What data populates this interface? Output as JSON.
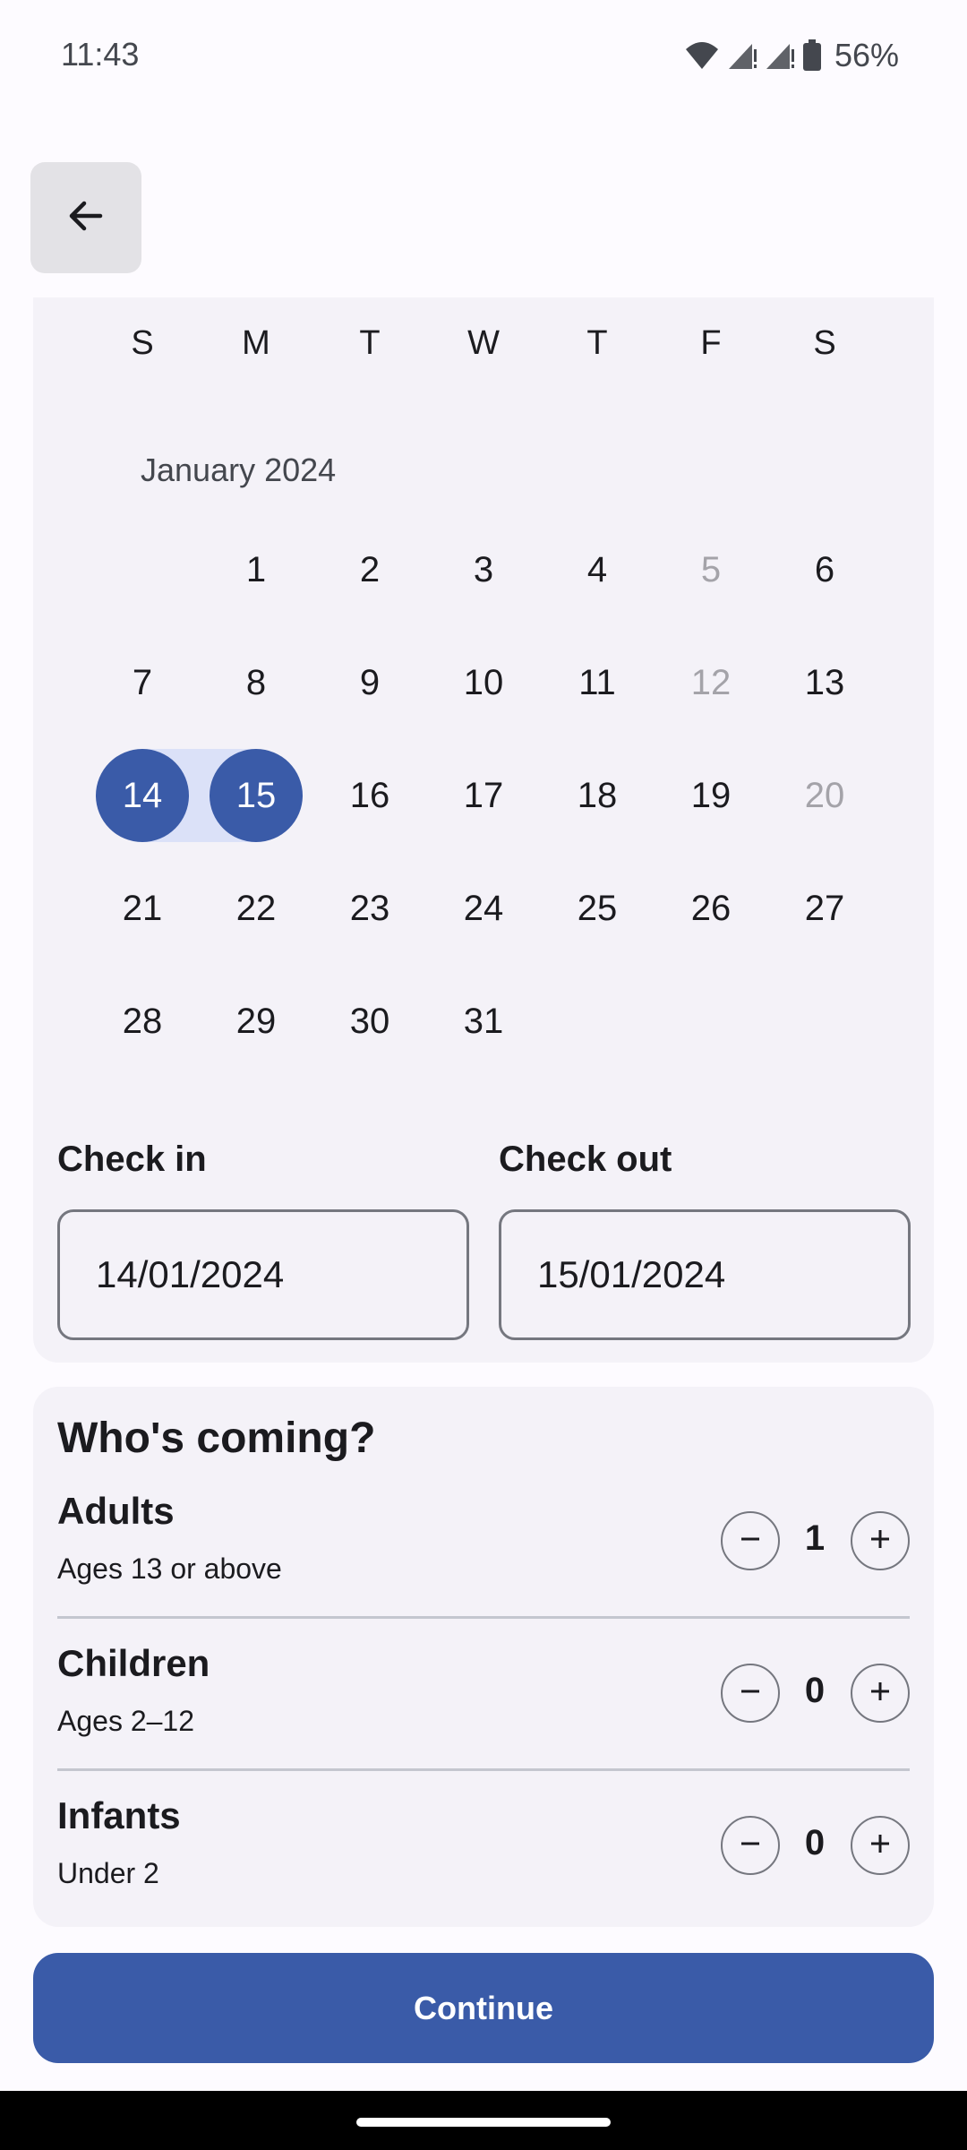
{
  "status_bar": {
    "time": "11:43",
    "battery": "56%",
    "icons": [
      "wifi-icon",
      "signal-icon",
      "signal-icon",
      "battery-icon"
    ]
  },
  "header": {
    "back_icon": "arrow-left-icon"
  },
  "calendar": {
    "weekdays": [
      "S",
      "M",
      "T",
      "W",
      "T",
      "F",
      "S"
    ],
    "month_label": "January 2024",
    "weeks": [
      [
        null,
        {
          "d": "1"
        },
        {
          "d": "2"
        },
        {
          "d": "3"
        },
        {
          "d": "4"
        },
        {
          "d": "5",
          "disabled": true
        },
        {
          "d": "6"
        }
      ],
      [
        {
          "d": "7"
        },
        {
          "d": "8"
        },
        {
          "d": "9"
        },
        {
          "d": "10"
        },
        {
          "d": "11"
        },
        {
          "d": "12",
          "disabled": true
        },
        {
          "d": "13"
        }
      ],
      [
        {
          "d": "14",
          "selected": true
        },
        {
          "d": "15",
          "selected": true
        },
        {
          "d": "16"
        },
        {
          "d": "17"
        },
        {
          "d": "18"
        },
        {
          "d": "19"
        },
        {
          "d": "20",
          "disabled": true
        }
      ],
      [
        {
          "d": "21"
        },
        {
          "d": "22"
        },
        {
          "d": "23"
        },
        {
          "d": "24"
        },
        {
          "d": "25"
        },
        {
          "d": "26"
        },
        {
          "d": "27"
        }
      ],
      [
        {
          "d": "28"
        },
        {
          "d": "29"
        },
        {
          "d": "30"
        },
        {
          "d": "31"
        },
        null,
        null,
        null
      ]
    ],
    "selection_color": "#3a5ba8",
    "range_color": "#dbe1f8"
  },
  "dates": {
    "check_in_label": "Check in",
    "check_in_value": "14/01/2024",
    "check_out_label": "Check out",
    "check_out_value": "15/01/2024"
  },
  "guests": {
    "title": "Who's coming?",
    "rows": [
      {
        "name": "Adults",
        "sub": "Ages 13 or above",
        "count": "1"
      },
      {
        "name": "Children",
        "sub": "Ages 2–12",
        "count": "0"
      },
      {
        "name": "Infants",
        "sub": "Under 2",
        "count": "0"
      }
    ]
  },
  "footer": {
    "continue_label": "Continue"
  },
  "colors": {
    "primary": "#3a5ba8",
    "surface": "#f4f2f8",
    "background": "#fdfbff"
  }
}
